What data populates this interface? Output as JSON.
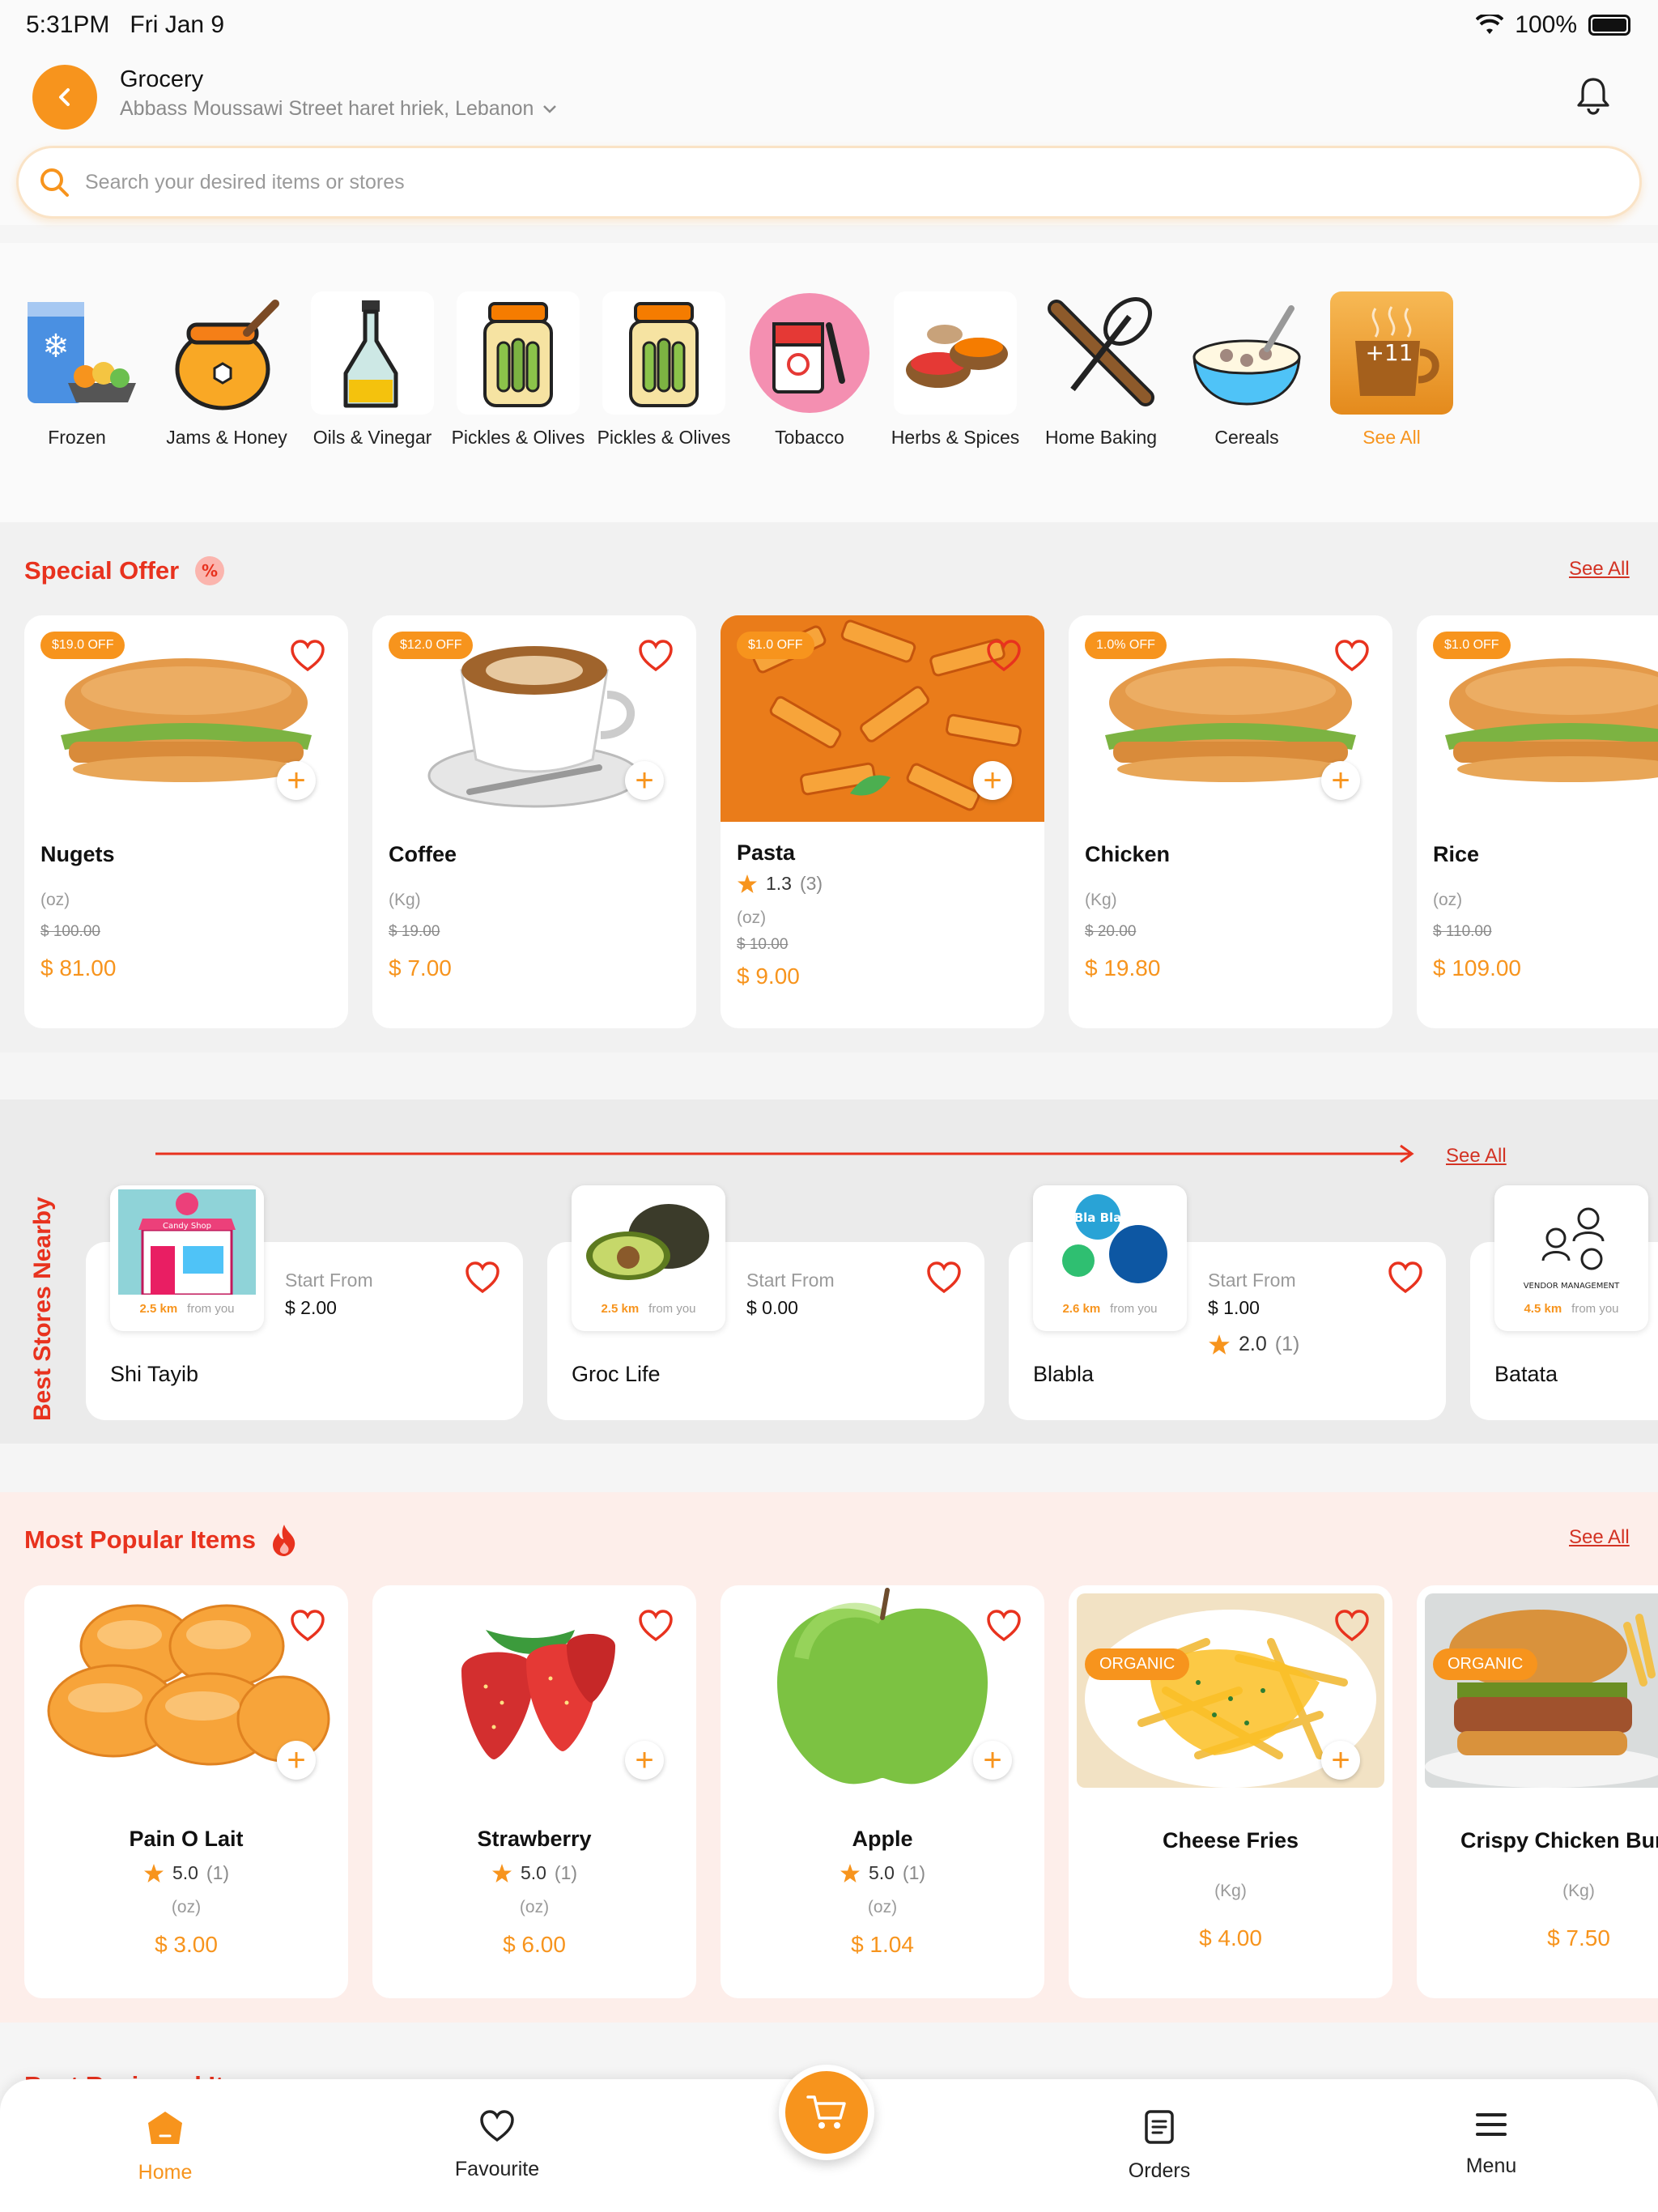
{
  "status": {
    "time": "5:31PM",
    "date": "Fri Jan 9",
    "battery": "100%"
  },
  "header": {
    "title": "Grocery",
    "address": "Abbass Moussawi Street haret hriek, Lebanon",
    "search_placeholder": "Search your desired items or stores"
  },
  "categories": [
    {
      "label": "Frozen",
      "icon": "frozen-bag-icon"
    },
    {
      "label": "Jams & Honey",
      "icon": "honey-pot-icon"
    },
    {
      "label": "Oils & Vinegar",
      "icon": "oil-bottle-icon"
    },
    {
      "label": "Pickles & Olives",
      "icon": "pickle-jar-icon"
    },
    {
      "label": "Pickles & Olives",
      "icon": "pickle-jar-icon"
    },
    {
      "label": "Tobacco",
      "icon": "tobacco-icon"
    },
    {
      "label": "Herbs & Spices",
      "icon": "spices-icon"
    },
    {
      "label": "Home Baking",
      "icon": "baking-icon"
    },
    {
      "label": "Cereals",
      "icon": "cereal-bowl-icon"
    },
    {
      "label": "See All",
      "overlay": "+11",
      "icon": "coffee-cup-icon"
    }
  ],
  "special_offer": {
    "title": "Special Offer",
    "see_all": "See All",
    "items": [
      {
        "badge": "$19.0 OFF",
        "name": "Nugets",
        "unit": "(oz)",
        "old_price": "$ 100.00",
        "price": "$ 81.00"
      },
      {
        "badge": "$12.0 OFF",
        "name": "Coffee",
        "unit": "(Kg)",
        "old_price": "$ 19.00",
        "price": "$ 7.00"
      },
      {
        "badge": "$1.0 OFF",
        "name": "Pasta",
        "rating": "1.3",
        "rating_count": "(3)",
        "unit": "(oz)",
        "old_price": "$ 10.00",
        "price": "$ 9.00"
      },
      {
        "badge": "1.0% OFF",
        "name": "Chicken",
        "unit": "(Kg)",
        "old_price": "$ 20.00",
        "price": "$ 19.80"
      },
      {
        "badge": "$1.0 OFF",
        "name": "Rice",
        "unit": "(oz)",
        "old_price": "$ 110.00",
        "price": "$ 109.00"
      }
    ]
  },
  "stores": {
    "title": "Best Stores Nearby",
    "see_all": "See All",
    "items": [
      {
        "name": "Shi Tayib",
        "start_from": "Start From",
        "price": "$ 2.00",
        "distance": "2.5 km",
        "from_you": "from you",
        "logo_text": "Candy Shop"
      },
      {
        "name": "Groc Life",
        "start_from": "Start From",
        "price": "$ 0.00",
        "distance": "2.5 km",
        "from_you": "from you"
      },
      {
        "name": "Blabla",
        "start_from": "Start From",
        "price": "$ 1.00",
        "rating": "2.0",
        "rating_count": "(1)",
        "distance": "2.6 km",
        "from_you": "from you",
        "logo_text": "Bla Bla"
      },
      {
        "name": "Batata",
        "start_from": "Start From",
        "price": "",
        "distance": "4.5 km",
        "from_you": "from you",
        "logo_text": "VENDOR MANAGEMENT"
      }
    ]
  },
  "popular": {
    "title": "Most Popular Items",
    "see_all": "See All",
    "items": [
      {
        "name": "Pain O Lait",
        "rating": "5.0",
        "rating_count": "(1)",
        "unit": "(oz)",
        "price": "$ 3.00"
      },
      {
        "name": "Strawberry",
        "rating": "5.0",
        "rating_count": "(1)",
        "unit": "(oz)",
        "price": "$ 6.00"
      },
      {
        "name": "Apple",
        "rating": "5.0",
        "rating_count": "(1)",
        "unit": "(oz)",
        "price": "$ 1.04"
      },
      {
        "name": "Cheese Fries",
        "tag": "ORGANIC",
        "unit": "(Kg)",
        "price": "$ 4.00"
      },
      {
        "name": "Crispy Chicken Bur",
        "tag": "ORGANIC",
        "unit": "(Kg)",
        "price": "$ 7.50"
      }
    ]
  },
  "next_section": {
    "title": "Best Reviewed Items"
  },
  "nav": {
    "home": "Home",
    "favourite": "Favourite",
    "orders": "Orders",
    "menu": "Menu"
  },
  "colors": {
    "accent": "#f7941d",
    "title_red": "#e8321e"
  }
}
